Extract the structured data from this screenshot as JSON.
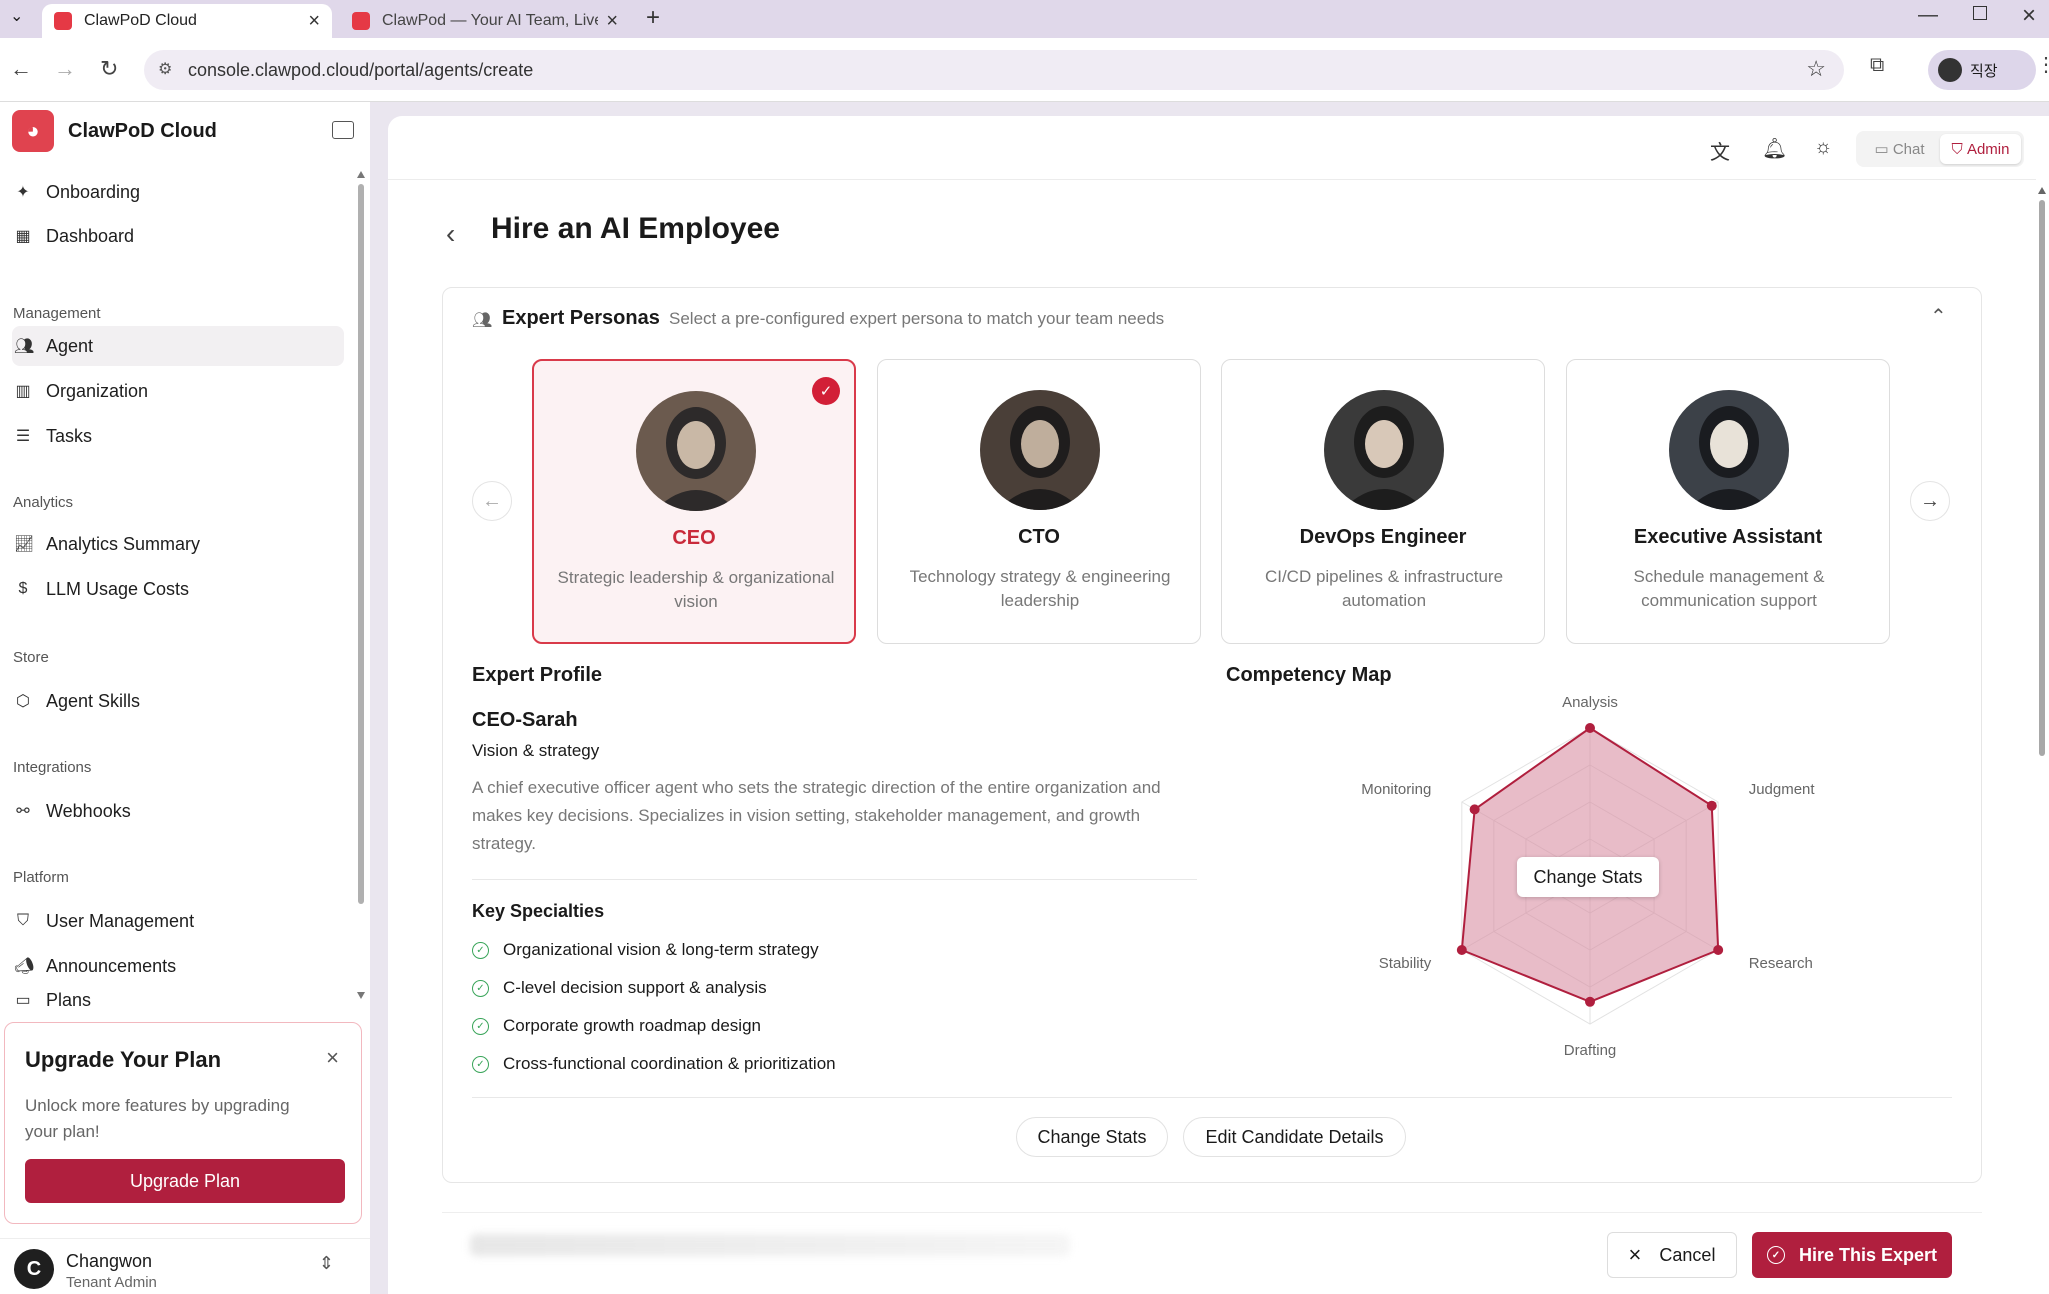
{
  "browser": {
    "tabs": [
      {
        "title": "ClawPoD Cloud"
      },
      {
        "title": "ClawPod — Your AI Team, Live"
      }
    ],
    "url": "console.clawpod.cloud/portal/agents/create",
    "profile_label": "직장"
  },
  "sidebar": {
    "brand": "ClawPoD Cloud",
    "top_items": [
      {
        "label": "Onboarding",
        "icon": "sparkle-icon"
      },
      {
        "label": "Dashboard",
        "icon": "grid-icon"
      }
    ],
    "sections": [
      {
        "title": "Management",
        "items": [
          {
            "label": "Agent",
            "icon": "users-icon",
            "active": true
          },
          {
            "label": "Organization",
            "icon": "building-icon"
          },
          {
            "label": "Tasks",
            "icon": "checklist-icon"
          }
        ]
      },
      {
        "title": "Analytics",
        "items": [
          {
            "label": "Analytics Summary",
            "icon": "chart-icon"
          },
          {
            "label": "LLM Usage Costs",
            "icon": "dollar-icon"
          }
        ]
      },
      {
        "title": "Store",
        "items": [
          {
            "label": "Agent Skills",
            "icon": "box-icon"
          }
        ]
      },
      {
        "title": "Integrations",
        "items": [
          {
            "label": "Webhooks",
            "icon": "webhook-icon"
          }
        ]
      },
      {
        "title": "Platform",
        "items": [
          {
            "label": "User Management",
            "icon": "shield-icon"
          },
          {
            "label": "Announcements",
            "icon": "megaphone-icon"
          },
          {
            "label": "Plans",
            "icon": "card-icon"
          }
        ]
      }
    ],
    "upgrade": {
      "title": "Upgrade Your Plan",
      "description": "Unlock more features by upgrading your plan!",
      "button": "Upgrade Plan"
    },
    "user": {
      "initial": "C",
      "name": "Changwon",
      "role": "Tenant Admin"
    }
  },
  "topbar": {
    "chat": "Chat",
    "admin": "Admin"
  },
  "page": {
    "title": "Hire an AI Employee"
  },
  "personas": {
    "title": "Expert Personas",
    "subtitle": "Select a pre-configured expert persona to match your team needs",
    "cards": [
      {
        "name": "CEO",
        "description": "Strategic leadership & organizational vision",
        "selected": true
      },
      {
        "name": "CTO",
        "description": "Technology strategy & engineering leadership",
        "selected": false
      },
      {
        "name": "DevOps Engineer",
        "description": "CI/CD pipelines & infrastructure automation",
        "selected": false
      },
      {
        "name": "Executive Assistant",
        "description": "Schedule management & communication support",
        "selected": false
      }
    ]
  },
  "profile": {
    "title": "Expert Profile",
    "name": "CEO-Sarah",
    "role": "Vision & strategy",
    "description": "A chief executive officer agent who sets the strategic direction of the entire organization and makes key decisions. Specializes in vision setting, stakeholder management, and growth strategy.",
    "specialties_title": "Key Specialties",
    "specialties": [
      "Organizational vision & long-term strategy",
      "C-level decision support & analysis",
      "Corporate growth roadmap design",
      "Cross-functional coordination & prioritization"
    ]
  },
  "competency": {
    "title": "Competency Map",
    "center_button": "Change Stats",
    "axes": [
      {
        "label": "Analysis",
        "value": 1.0
      },
      {
        "label": "Judgment",
        "value": 0.95
      },
      {
        "label": "Research",
        "value": 1.0
      },
      {
        "label": "Drafting",
        "value": 0.85
      },
      {
        "label": "Stability",
        "value": 1.0
      },
      {
        "label": "Monitoring",
        "value": 0.9
      }
    ],
    "fill_color": "#d98fa3",
    "stroke_color": "#b01f3e"
  },
  "actions": {
    "change_stats": "Change Stats",
    "edit_details": "Edit Candidate Details",
    "cancel": "Cancel",
    "hire": "Hire This Expert"
  }
}
